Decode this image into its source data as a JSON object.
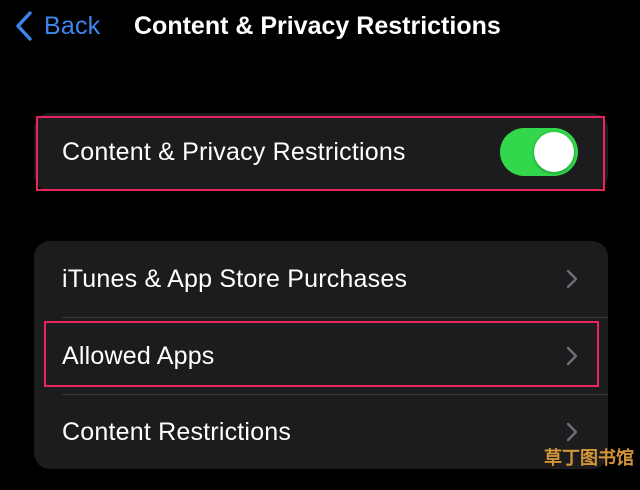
{
  "nav": {
    "back_label": "Back",
    "title": "Content & Privacy Restrictions",
    "back_icon": "chevron-left-icon"
  },
  "master": {
    "label": "Content & Privacy Restrictions",
    "toggle_on": true
  },
  "list": {
    "items": [
      {
        "label": "iTunes & App Store Purchases",
        "icon": "chevron-right-icon"
      },
      {
        "label": "Allowed Apps",
        "icon": "chevron-right-icon"
      },
      {
        "label": "Content Restrictions",
        "icon": "chevron-right-icon"
      }
    ]
  },
  "watermark": "草丁图书馆",
  "colors": {
    "accent": "#3d86f0",
    "toggle_on": "#32d74b",
    "highlight": "#e8245a",
    "cell_bg": "#1c1c1e",
    "background": "#000000"
  }
}
